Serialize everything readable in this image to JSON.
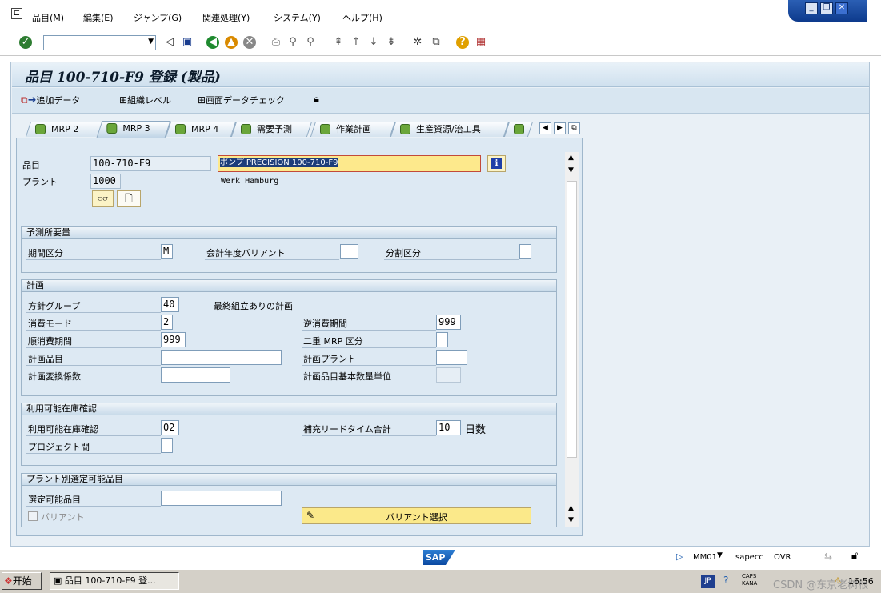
{
  "menu": {
    "items": [
      "品目(M)",
      "編集(E)",
      "ジャンプ(G)",
      "関連処理(Y)",
      "システム(Y)",
      "ヘルプ(H)"
    ]
  },
  "window_controls": {
    "minimize": "_",
    "restore": "❐",
    "close": "✕"
  },
  "command_field": {
    "value": ""
  },
  "title": "品目 100-710-F9 登録 (製品)",
  "app_toolbar": {
    "add_data": "追加データ",
    "org_levels": "組織レベル",
    "check_screen_data": "画面データチェック"
  },
  "tabs": [
    "MRP 2",
    "MRP 3",
    "MRP 4",
    "需要予測",
    "作業計画",
    "生産資源/治工具",
    ""
  ],
  "active_tab": "MRP 3",
  "header": {
    "material_label": "品目",
    "material_value": "100-710-F9",
    "material_desc": "ポンプ PRECISION 100-710-F9",
    "plant_label": "プラント",
    "plant_value": "1000",
    "plant_desc": "Werk Hamburg"
  },
  "forecast": {
    "title": "予測所要量",
    "period_label": "期間区分",
    "period_value": "M",
    "fy_variant_label": "会計年度バリアント",
    "fy_variant_value": "",
    "split_label": "分割区分",
    "split_value": ""
  },
  "planning": {
    "title": "計画",
    "strategy_group_label": "方針グループ",
    "strategy_group_value": "40",
    "strategy_group_desc": "最終組立ありの計画",
    "consumption_mode_label": "消費モード",
    "consumption_mode_value": "2",
    "backward_label": "逆消費期間",
    "backward_value": "999",
    "forward_label": "順消費期間",
    "forward_value": "999",
    "mixed_mrp_label": "二重 MRP 区分",
    "mixed_mrp_value": "",
    "planning_material_label": "計画品目",
    "planning_material_value": "",
    "planning_plant_label": "計画プラント",
    "planning_plant_value": "",
    "conv_factor_label": "計画変換係数",
    "conv_factor_value": "",
    "base_uom_label": "計画品目基本数量単位",
    "base_uom_value": ""
  },
  "availability": {
    "title": "利用可能在庫確認",
    "check_label": "利用可能在庫確認",
    "check_value": "02",
    "rlt_label": "補充リードタイム合計",
    "rlt_value": "10",
    "rlt_unit": "日数",
    "cross_project_label": "プロジェクト間",
    "cross_project_value": ""
  },
  "configurable": {
    "title": "プラント別選定可能品目",
    "config_material_label": "選定可能品目",
    "config_material_value": "",
    "variant_label": "バリアント",
    "variant_select_button": "バリアント選択"
  },
  "status": {
    "tcode": "MM01",
    "server": "sapecc",
    "mode": "OVR",
    "sap_logo": "SAP"
  },
  "taskbar": {
    "start": "开始",
    "task": "品目 100-710-F9 登...",
    "lang": "JP",
    "ime": "CAPS KANA",
    "watermark": "CSDN @东京老树根",
    "clock": "16:56"
  },
  "colors": {
    "highlight_field": "#fde98c",
    "frame_bg": "#dde9f3",
    "header_bg": "#cfe0ee",
    "tab_icon": "#6aa63a",
    "taskbar": "#d4d0c8"
  }
}
